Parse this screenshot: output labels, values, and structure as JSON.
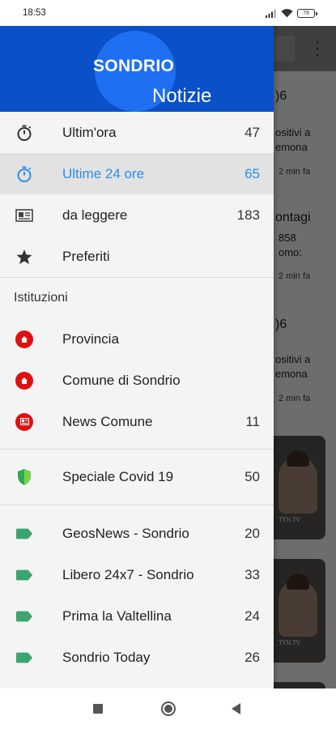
{
  "status_bar": {
    "time": "18:53",
    "battery": "78"
  },
  "header": {
    "brand_top": "SONDRIO",
    "brand_bottom": "Notizie"
  },
  "menu": [
    {
      "label": "Ultim'ora",
      "count": "47",
      "icon": "stopwatch-icon"
    },
    {
      "label": "Ultime 24 ore",
      "count": "65",
      "icon": "stopwatch-icon",
      "active": true
    },
    {
      "label": "da leggere",
      "count": "183",
      "icon": "newspaper-icon"
    },
    {
      "label": "Preferiti",
      "count": "",
      "icon": "star-icon"
    }
  ],
  "institutions": {
    "title": "Istituzioni",
    "items": [
      {
        "label": "Provincia",
        "count": "",
        "icon": "home-icon"
      },
      {
        "label": "Comune di Sondrio",
        "count": "",
        "icon": "home-icon"
      },
      {
        "label": "News Comune",
        "count": "11",
        "icon": "newspaper-icon"
      }
    ]
  },
  "special": {
    "label": "Speciale Covid 19",
    "count": "50",
    "icon": "shield-icon"
  },
  "sources": [
    {
      "label": "GeosNews - Sondrio",
      "count": "20",
      "icon": "tag-icon"
    },
    {
      "label": "Libero 24x7 - Sondrio",
      "count": "33",
      "icon": "tag-icon"
    },
    {
      "label": "Prima la Valtellina",
      "count": "24",
      "icon": "tag-icon"
    },
    {
      "label": "Sondrio Today",
      "count": "26",
      "icon": "tag-icon"
    }
  ],
  "background": {
    "item1": {
      "title": ")6",
      "line1": "ositivi a",
      "line2": "emona",
      "time": "2 min fa"
    },
    "item2": {
      "title": "ontagi",
      "line1": "858",
      "line2": "omo:",
      "time": "2 min fa"
    },
    "item3": {
      "title": ")6",
      "line1": "ositivi a",
      "line2": "emona",
      "time": "2 min fa"
    },
    "card_caption": "TYN.TV"
  },
  "colors": {
    "accent": "#2b8de6",
    "header": "#0a50c8",
    "red": "#e01010",
    "green_tag": "#3aa56e",
    "covid_shield": "#2fa84f"
  }
}
